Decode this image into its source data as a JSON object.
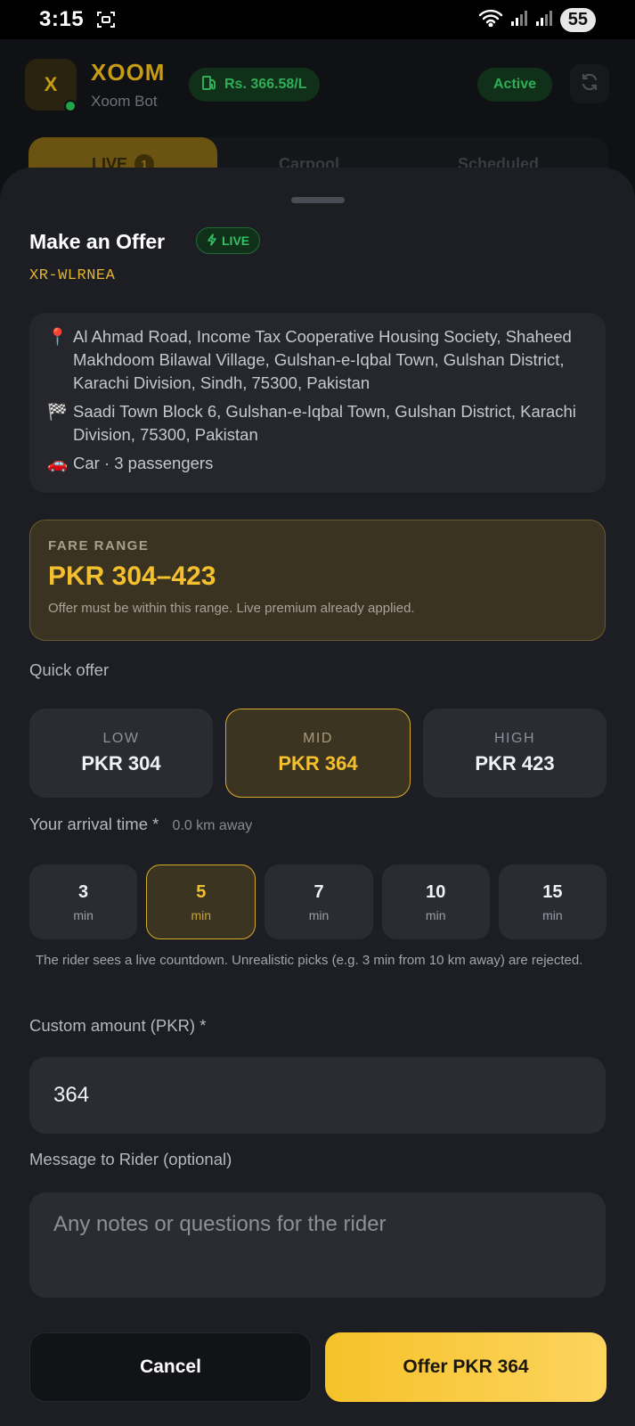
{
  "status_bar": {
    "time": "3:15",
    "battery": "55",
    "icons": [
      "screenshot-icon",
      "wifi-icon",
      "signal-icon",
      "signal-icon",
      "battery-icon"
    ]
  },
  "background_app": {
    "avatar_letter": "X",
    "brand": "XOOM",
    "subtitle": "Xoom Bot",
    "fuel_price": "Rs. 366.58/L",
    "status": "Active",
    "tabs": [
      {
        "label": "LIVE",
        "count": "1"
      },
      {
        "label": "Carpool"
      },
      {
        "label": "Scheduled"
      }
    ]
  },
  "sheet": {
    "title": "Make an Offer",
    "live_badge": "LIVE",
    "ride_id": "XR-WLRNEA",
    "route": {
      "pickup_icon": "📍",
      "pickup": "Al Ahmad Road, Income Tax Cooperative Housing Society, Shaheed Makhdoom Bilawal Village, Gulshan-e-Iqbal Town, Gulshan District, Karachi Division, Sindh, 75300, Pakistan",
      "dropoff_icon": "🏁",
      "dropoff": "Saadi Town Block 6, Gulshan-e-Iqbal Town, Gulshan District, Karachi Division, 75300, Pakistan",
      "vehicle_icon": "🚗",
      "vehicle": "Car · 3 passengers"
    },
    "fare": {
      "label": "FARE RANGE",
      "range": "PKR 304–423",
      "note": "Offer must be within this range. Live premium already applied."
    },
    "quick_offer": {
      "label": "Quick offer",
      "options": [
        {
          "tier": "LOW",
          "price": "PKR 304",
          "selected": false
        },
        {
          "tier": "MID",
          "price": "PKR 364",
          "selected": true
        },
        {
          "tier": "HIGH",
          "price": "PKR 423",
          "selected": false
        }
      ]
    },
    "arrival": {
      "label": "Your arrival time",
      "required_mark": "*",
      "distance": "0.0 km away",
      "options": [
        {
          "value": "3",
          "unit": "min",
          "selected": false
        },
        {
          "value": "5",
          "unit": "min",
          "selected": true
        },
        {
          "value": "7",
          "unit": "min",
          "selected": false
        },
        {
          "value": "10",
          "unit": "min",
          "selected": false
        },
        {
          "value": "15",
          "unit": "min",
          "selected": false
        }
      ],
      "note": "The rider sees a live countdown. Unrealistic picks (e.g. 3 min from 10 km away) are rejected."
    },
    "custom_amount": {
      "label": "Custom amount (PKR)",
      "required_mark": "*",
      "value": "364"
    },
    "message": {
      "label": "Message to Rider (optional)",
      "placeholder": "Any notes or questions for the rider",
      "value": ""
    },
    "actions": {
      "cancel": "Cancel",
      "offer": "Offer PKR 364"
    }
  }
}
